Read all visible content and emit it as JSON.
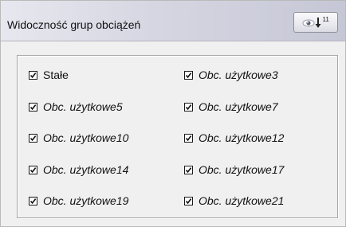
{
  "panel": {
    "title": "Widoczność grup obciążeń",
    "button": {
      "icon": "eye-sort-icon",
      "superscript": "11"
    }
  },
  "groups": [
    {
      "label": "Stałe",
      "checked": true,
      "italic": false
    },
    {
      "label": "Obc. użytkowe3",
      "checked": true,
      "italic": true
    },
    {
      "label": "Obc. użytkowe5",
      "checked": true,
      "italic": true
    },
    {
      "label": "Obc. użytkowe7",
      "checked": true,
      "italic": true
    },
    {
      "label": "Obc. użytkowe10",
      "checked": true,
      "italic": true
    },
    {
      "label": "Obc. użytkowe12",
      "checked": true,
      "italic": true
    },
    {
      "label": "Obc. użytkowe14",
      "checked": true,
      "italic": true
    },
    {
      "label": "Obc. użytkowe17",
      "checked": true,
      "italic": true
    },
    {
      "label": "Obc. użytkowe19",
      "checked": true,
      "italic": true
    },
    {
      "label": "Obc. użytkowe21",
      "checked": true,
      "italic": true
    }
  ]
}
